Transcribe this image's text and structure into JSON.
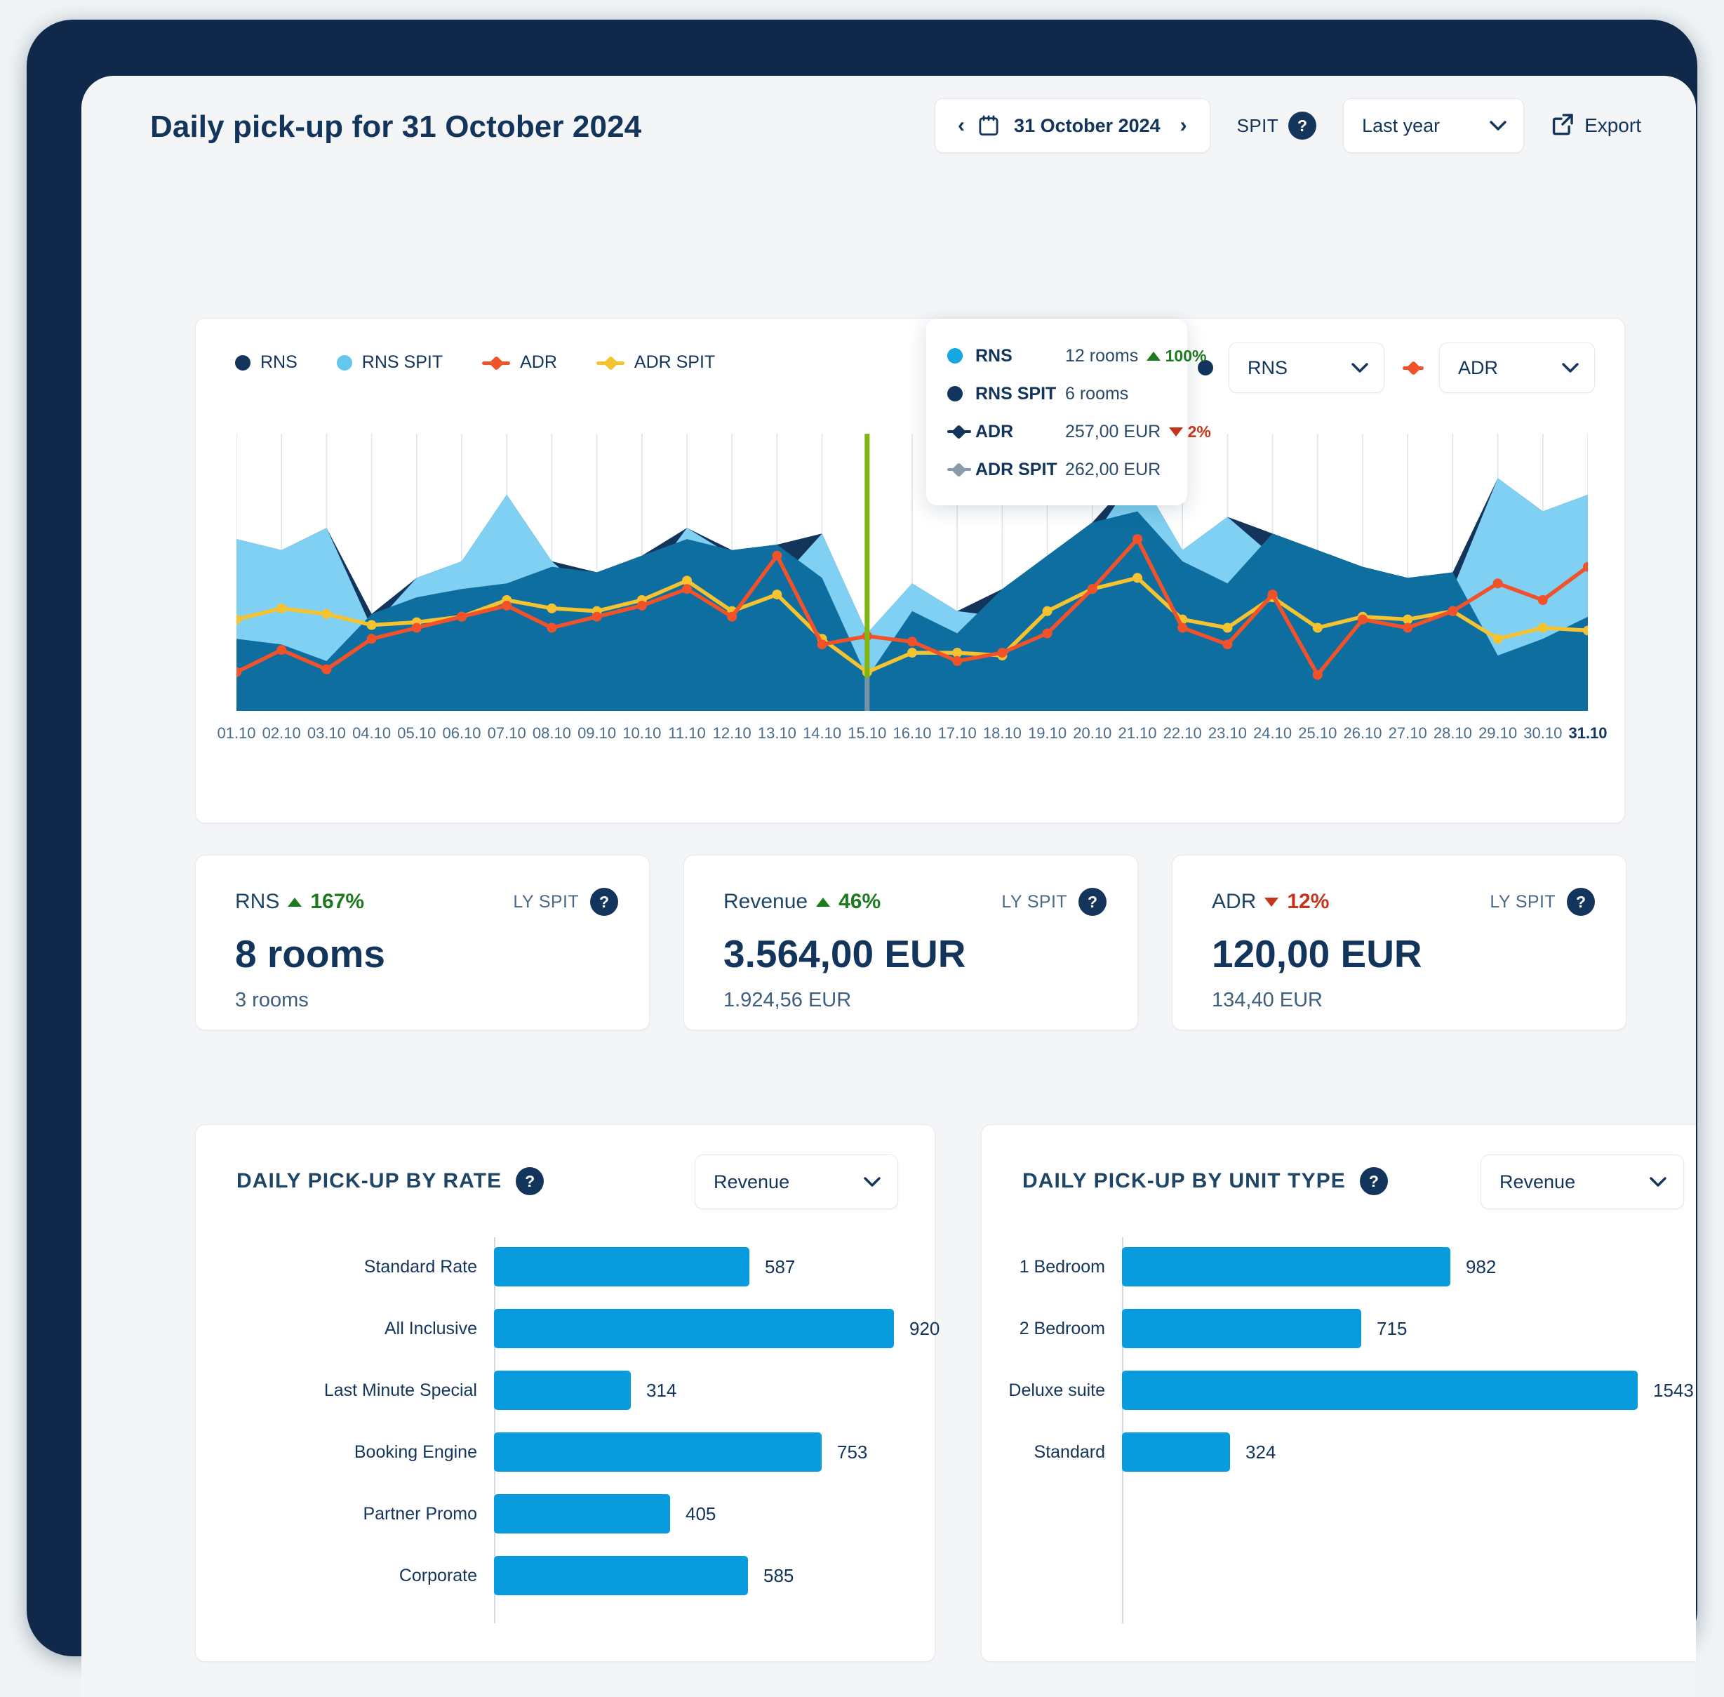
{
  "header": {
    "title": "Daily pick-up for 31 October 2024",
    "date_picker": {
      "value": "31 October 2024",
      "prev": "‹",
      "next": "›"
    },
    "spit_label": "SPIT",
    "help": "?",
    "comparison_select": "Last year",
    "export_label": "Export"
  },
  "chart_card": {
    "legend": [
      {
        "label": "RNS",
        "type": "dot",
        "color": "#13355c"
      },
      {
        "label": "RNS SPIT",
        "type": "dot",
        "color": "#66c7ee"
      },
      {
        "label": "ADR",
        "type": "line",
        "color": "#f1522a"
      },
      {
        "label": "ADR SPIT",
        "type": "line",
        "color": "#f6c330"
      }
    ],
    "series_select_left": "RNS",
    "series_select_right": "ADR",
    "tooltip": {
      "rows": [
        {
          "name": "RNS",
          "value": "12 rooms",
          "delta": "100%",
          "dir": "up",
          "marker": "dot",
          "color": "#15a7e0"
        },
        {
          "name": "RNS SPIT",
          "value": "6 rooms",
          "delta": "",
          "dir": "",
          "marker": "dot",
          "color": "#13355c"
        },
        {
          "name": "ADR",
          "value": "257,00 EUR",
          "delta": "2%",
          "dir": "down",
          "marker": "line",
          "color": "#13355c"
        },
        {
          "name": "ADR SPIT",
          "value": "262,00 EUR",
          "delta": "",
          "dir": "",
          "marker": "line",
          "color": "#8a9aa8"
        }
      ]
    }
  },
  "chart_data": {
    "type": "area",
    "title": "Daily pick-up",
    "xlabel": "",
    "ylabel": "",
    "grid": true,
    "legend_position": "top-left",
    "highlight_category": "15.10",
    "categories": [
      "01.10",
      "02.10",
      "03.10",
      "04.10",
      "05.10",
      "06.10",
      "07.10",
      "08.10",
      "09.10",
      "10.10",
      "11.10",
      "12.10",
      "13.10",
      "14.10",
      "15.10",
      "16.10",
      "17.10",
      "18.10",
      "19.10",
      "20.10",
      "21.10",
      "22.10",
      "23.10",
      "24.10",
      "25.10",
      "26.10",
      "27.10",
      "28.10",
      "29.10",
      "30.10",
      "31.10"
    ],
    "series": [
      {
        "name": "RNS",
        "kind": "area",
        "color": "#0e6ea0",
        "values": [
          26,
          24,
          18,
          35,
          41,
          44,
          46,
          52,
          50,
          56,
          62,
          58,
          60,
          48,
          12,
          36,
          28,
          44,
          56,
          68,
          72,
          54,
          46,
          64,
          58,
          52,
          48,
          50,
          20,
          26,
          34
        ]
      },
      {
        "name": "RNS SPIT",
        "kind": "area",
        "color": "#7fd0f2",
        "values": [
          62,
          58,
          66,
          30,
          48,
          54,
          78,
          54,
          40,
          44,
          66,
          56,
          46,
          64,
          28,
          46,
          36,
          34,
          40,
          62,
          86,
          58,
          70,
          56,
          42,
          46,
          42,
          44,
          84,
          72,
          78
        ]
      },
      {
        "name": "ADR",
        "kind": "line",
        "color": "#f1522a",
        "values": [
          14,
          22,
          15,
          26,
          30,
          34,
          38,
          30,
          34,
          38,
          44,
          34,
          56,
          24,
          27,
          25,
          18,
          21,
          28,
          44,
          62,
          30,
          24,
          42,
          13,
          33,
          30,
          36,
          46,
          40,
          52
        ]
      },
      {
        "name": "ADR SPIT",
        "kind": "line",
        "color": "#f6c330",
        "values": [
          33,
          37,
          35,
          31,
          32,
          34,
          40,
          37,
          36,
          40,
          47,
          36,
          42,
          26,
          14,
          21,
          21,
          20,
          36,
          44,
          48,
          33,
          30,
          41,
          30,
          34,
          33,
          36,
          26,
          30,
          29
        ]
      }
    ]
  },
  "kpis": [
    {
      "label": "RNS",
      "pct": "167%",
      "dir": "up",
      "ly_label": "LY SPIT",
      "main": "8 rooms",
      "sub": "3 rooms"
    },
    {
      "label": "Revenue",
      "pct": "46%",
      "dir": "up",
      "ly_label": "LY SPIT",
      "main": "3.564,00 EUR",
      "sub": "1.924,56 EUR"
    },
    {
      "label": "ADR",
      "pct": "12%",
      "dir": "down",
      "ly_label": "LY SPIT",
      "main": "120,00 EUR",
      "sub": "134,40 EUR"
    }
  ],
  "panel_rate": {
    "title": "DAILY PICK-UP BY RATE",
    "help": "?",
    "metric_select": "Revenue",
    "chart_data": {
      "type": "bar",
      "orientation": "horizontal",
      "title": "DAILY PICK-UP BY RATE",
      "xlabel": "",
      "ylabel": "",
      "categories": [
        "Standard Rate",
        "All Inclusive",
        "Last Minute Special",
        "Booking Engine",
        "Partner Promo",
        "Corporate"
      ],
      "values": [
        587,
        920,
        314,
        753,
        405,
        585
      ],
      "xlim": [
        0,
        920
      ]
    }
  },
  "panel_unit": {
    "title": "DAILY PICK-UP BY UNIT TYPE",
    "help": "?",
    "metric_select": "Revenue",
    "chart_data": {
      "type": "bar",
      "orientation": "horizontal",
      "title": "DAILY PICK-UP BY UNIT TYPE",
      "xlabel": "",
      "ylabel": "",
      "categories": [
        "1 Bedroom",
        "2 Bedroom",
        "Deluxe suite",
        "Standard"
      ],
      "values": [
        982,
        715,
        1543,
        324
      ],
      "xlim": [
        0,
        1543
      ]
    }
  },
  "colors": {
    "brand_navy": "#13355c",
    "rns_area": "#0e6ea0",
    "rns_spit_area": "#7fd0f2",
    "adr_line": "#f1522a",
    "adr_spit_line": "#f6c330",
    "bar_blue": "#089cdf",
    "positive": "#1e7a1e",
    "negative": "#c4361c",
    "highlight": "#e4efc0",
    "highlight_line": "#7fb515"
  }
}
